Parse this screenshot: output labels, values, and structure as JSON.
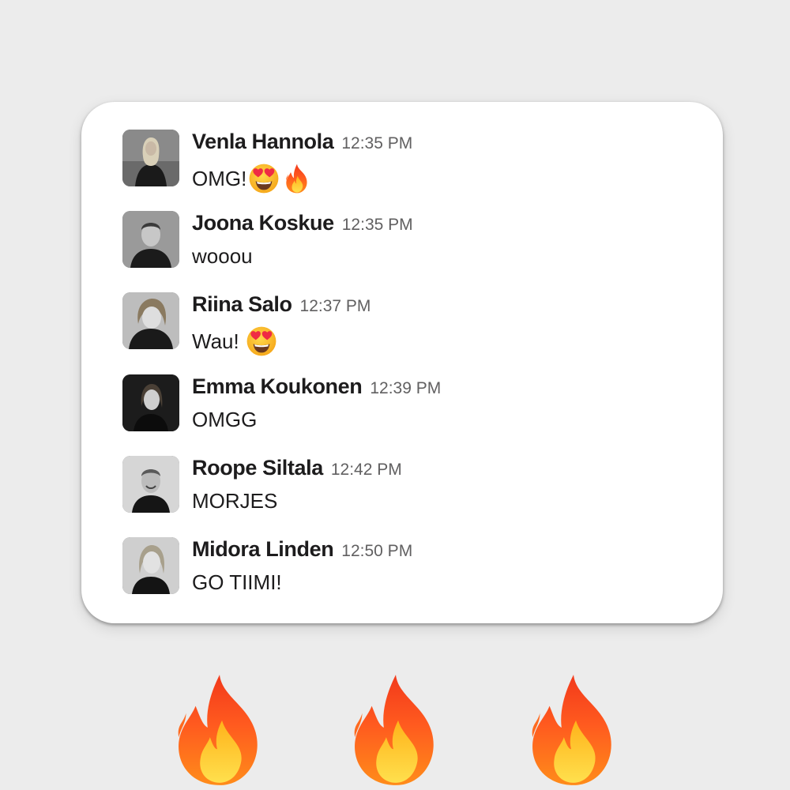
{
  "messages": [
    {
      "name": "Venla Hannola",
      "time": "12:35 PM",
      "text": "OMG!",
      "emojis": [
        "heart-eyes",
        "fire"
      ],
      "avatar": "photo-woman-blonde-long-hair"
    },
    {
      "name": "Joona Koskue",
      "time": "12:35 PM",
      "text": "wooou",
      "emojis": [],
      "avatar": "photo-man-short-hair"
    },
    {
      "name": "Riina Salo",
      "time": "12:37 PM",
      "text": "Wau! ",
      "emojis": [
        "heart-eyes"
      ],
      "avatar": "photo-woman-smiling"
    },
    {
      "name": "Emma Koukonen",
      "time": "12:39 PM",
      "text": "OMGG",
      "emojis": [],
      "avatar": "photo-woman-dark-background"
    },
    {
      "name": "Roope Siltala",
      "time": "12:42 PM",
      "text": "MORJES",
      "emojis": [],
      "avatar": "photo-man-smiling"
    },
    {
      "name": "Midora Linden",
      "time": "12:50 PM",
      "text": "GO TIIMI!",
      "emojis": [],
      "avatar": "photo-woman-blonde"
    }
  ],
  "decorations": {
    "big_emojis": [
      "fire",
      "fire",
      "fire"
    ]
  },
  "colors": {
    "background": "#ececec",
    "card": "#ffffff",
    "name_text": "#1d1c1d",
    "time_text": "#616061"
  }
}
